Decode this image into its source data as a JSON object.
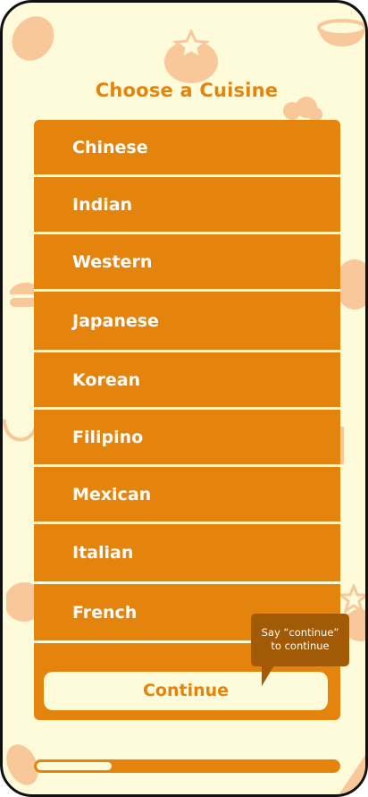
{
  "screen": {
    "title": "Choose a Cuisine"
  },
  "cuisines": [
    {
      "label": "Chinese"
    },
    {
      "label": "Indian"
    },
    {
      "label": "Western"
    },
    {
      "label": "Japanese"
    },
    {
      "label": "Korean"
    },
    {
      "label": "Filipino"
    },
    {
      "label": "Mexican"
    },
    {
      "label": "Italian"
    },
    {
      "label": "French"
    }
  ],
  "continue_button": {
    "label": "Continue"
  },
  "tooltip": {
    "line1": "Say “continue”",
    "line2": "to continue"
  },
  "progress": {
    "fraction": 0.25
  },
  "colors": {
    "accent": "#e5840d",
    "background": "#fdfbd9",
    "tooltip": "#a25a07",
    "decoration": "#f9c89a"
  },
  "decorations": [
    "tomato-icon",
    "bowl-icon",
    "dish-icon",
    "cloche-icon",
    "star-icon"
  ]
}
